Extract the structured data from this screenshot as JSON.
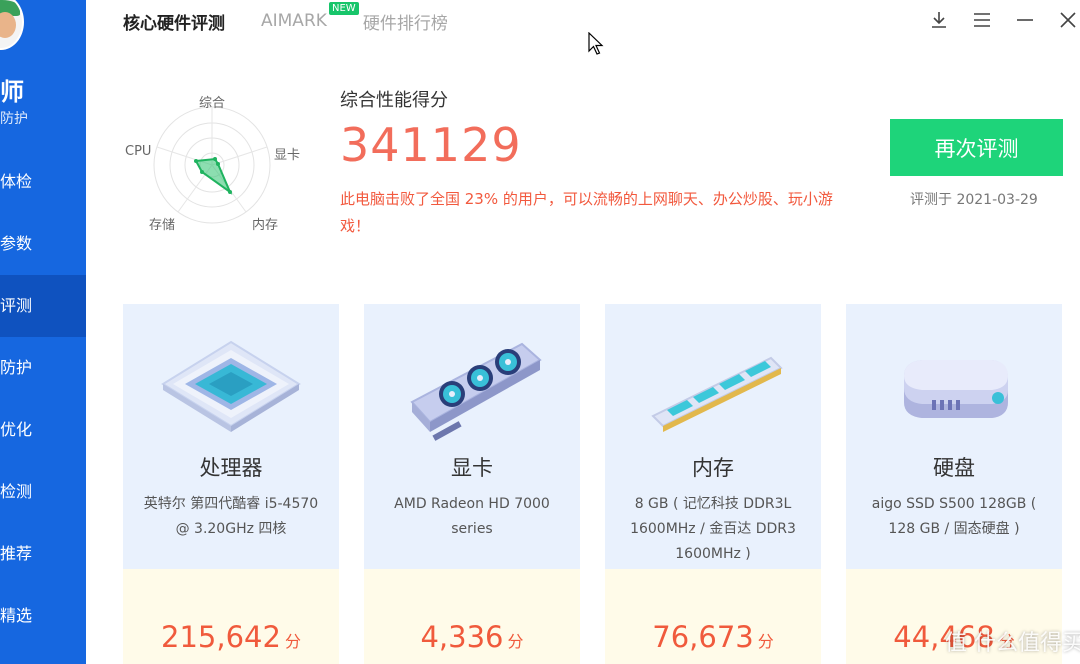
{
  "sidebar": {
    "brand": "师",
    "brand_sub": "防护",
    "items": [
      {
        "label": "体检"
      },
      {
        "label": "参数"
      },
      {
        "label": "评测",
        "active": true
      },
      {
        "label": "防护"
      },
      {
        "label": "优化"
      },
      {
        "label": "检测"
      },
      {
        "label": "推荐"
      },
      {
        "label": "精选"
      }
    ]
  },
  "tabs": [
    {
      "label": "核心硬件评测",
      "active": true
    },
    {
      "label": "AIMARK",
      "badge": "NEW"
    },
    {
      "label": "硬件排行榜"
    }
  ],
  "window": {
    "icons": [
      "download-icon",
      "menu-icon",
      "minimize-icon",
      "close-icon"
    ]
  },
  "radar": {
    "labels": [
      "综合",
      "显卡",
      "内存",
      "存储",
      "CPU"
    ]
  },
  "score": {
    "title": "综合性能得分",
    "value": "341129",
    "description": "此电脑击败了全国 23% 的用户，可以流畅的上网聊天、办公炒股、玩小游戏！",
    "retest_label": "再次评测",
    "date": "评测于 2021-03-29"
  },
  "cards": [
    {
      "name": "处理器",
      "desc": "英特尔 第四代酷睿 i5-4570 @ 3.20GHz 四核",
      "score": "215,642",
      "unit": "分",
      "icon": "cpu-chip-icon"
    },
    {
      "name": "显卡",
      "desc": "AMD Radeon HD 7000 series",
      "score": "4,336",
      "unit": "分",
      "icon": "graphics-card-icon"
    },
    {
      "name": "内存",
      "desc": "8 GB ( 记忆科技 DDR3L 1600MHz / 金百达 DDR3 1600MHz )",
      "score": "76,673",
      "unit": "分",
      "icon": "memory-stick-icon"
    },
    {
      "name": "硬盘",
      "desc": "aigo SSD S500 128GB ( 128 GB / 固态硬盘 )",
      "score": "44,468",
      "unit": "分",
      "icon": "hard-drive-icon"
    }
  ],
  "watermark": "值 什么值得买",
  "colors": {
    "sidebar": "#1667e0",
    "accent_red": "#f26d5b",
    "button_green": "#1ed47a",
    "radar_green": "#2ec26f"
  }
}
